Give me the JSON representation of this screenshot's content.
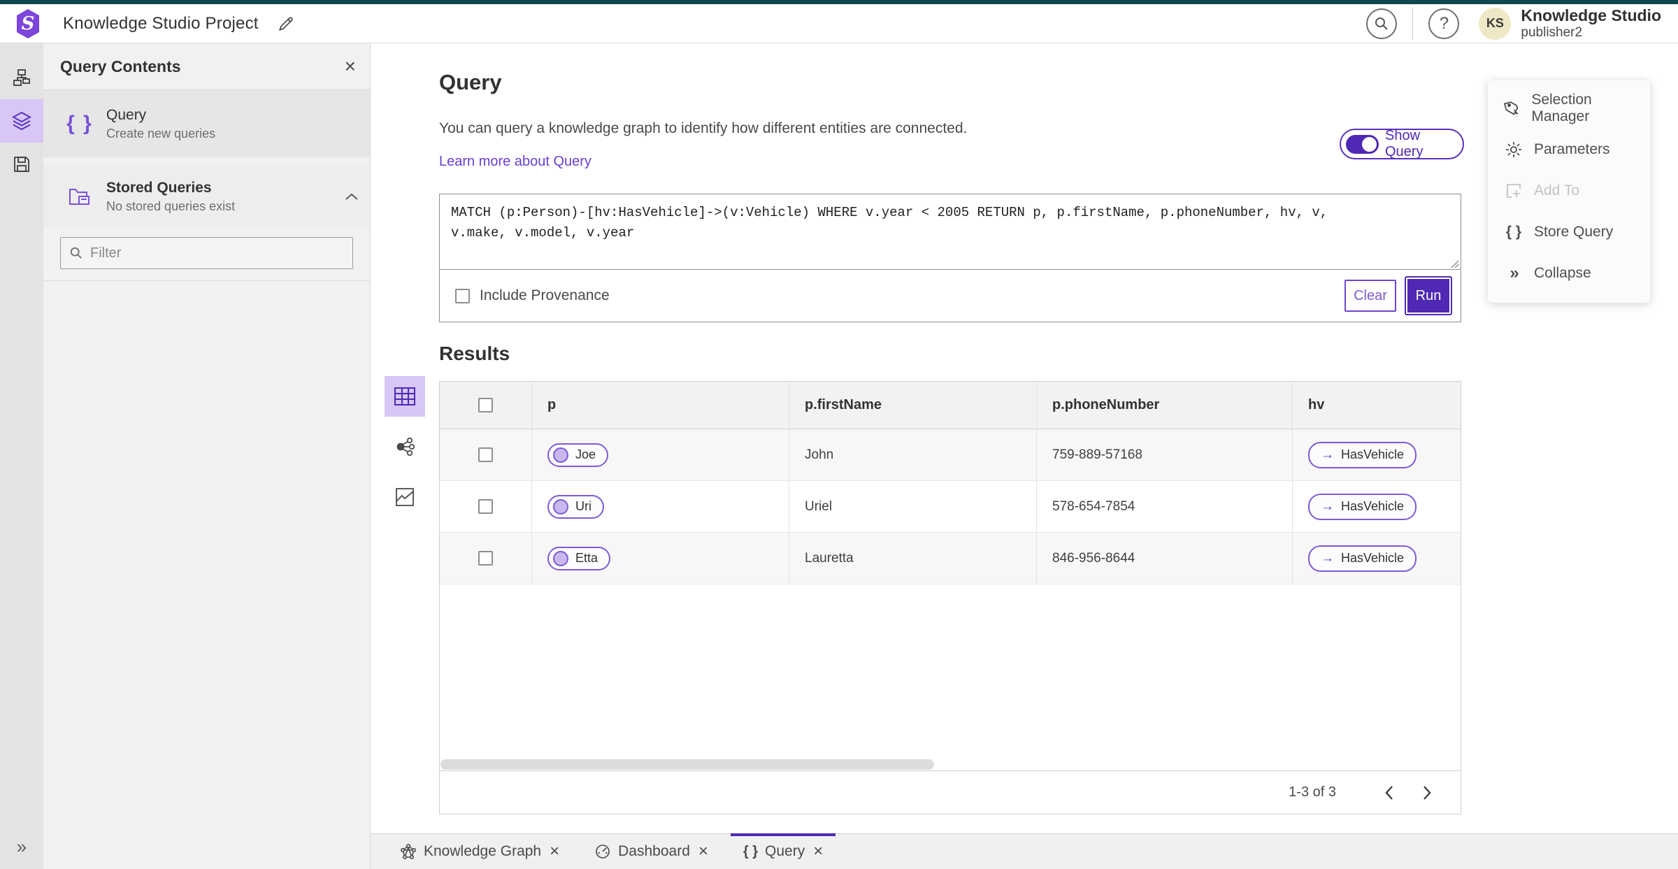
{
  "colors": {
    "accent": "#4f28b4",
    "accent_border": "#7e5bd4",
    "accent_light_bg": "#d7c6f6",
    "link": "#6a3fd1",
    "teal_strip": "#10474e",
    "avatar_bg": "#eee8c6"
  },
  "header": {
    "app_title": "Knowledge Studio Project",
    "user_name": "Knowledge Studio",
    "user_role": "publisher2",
    "avatar_initials": "KS"
  },
  "icons": {
    "help_glyph": "?",
    "close_glyph": "×",
    "braces_glyph": "{ }",
    "collapse_glyph": "»",
    "expand_glyph": "»",
    "rel_arrow_glyph": "→"
  },
  "panel": {
    "title": "Query Contents",
    "items": [
      {
        "title": "Query",
        "subtitle": "Create new queries"
      },
      {
        "title": "Stored Queries",
        "subtitle": "No stored queries exist"
      }
    ],
    "filter_placeholder": "Filter"
  },
  "query_section": {
    "title": "Query",
    "description": "You can query a knowledge graph to identify how different entities are connected.",
    "link": "Learn more about Query",
    "show_query_label": "Show Query",
    "query_text": "MATCH (p:Person)-[hv:HasVehicle]->(v:Vehicle) WHERE v.year < 2005 RETURN p, p.firstName, p.phoneNumber, hv, v,\nv.make, v.model, v.year",
    "include_provenance_label": "Include Provenance",
    "clear_label": "Clear",
    "run_label": "Run"
  },
  "results": {
    "title": "Results",
    "columns": [
      "p",
      "p.firstName",
      "p.phoneNumber",
      "hv"
    ],
    "rows": [
      {
        "p": "Joe",
        "firstName": "John",
        "phone": "759-889-57168",
        "hv": "HasVehicle"
      },
      {
        "p": "Uri",
        "firstName": "Uriel",
        "phone": "578-654-7854",
        "hv": "HasVehicle"
      },
      {
        "p": "Etta",
        "firstName": "Lauretta",
        "phone": "846-956-8644",
        "hv": "HasVehicle"
      }
    ],
    "pagination": "1-3 of 3"
  },
  "right_panel": {
    "items": [
      {
        "label": "Selection Manager"
      },
      {
        "label": "Parameters"
      },
      {
        "label": "Add To"
      },
      {
        "label": "Store Query"
      },
      {
        "label": "Collapse"
      }
    ]
  },
  "tabs": [
    {
      "label": "Knowledge Graph"
    },
    {
      "label": "Dashboard"
    },
    {
      "label": "Query"
    }
  ]
}
